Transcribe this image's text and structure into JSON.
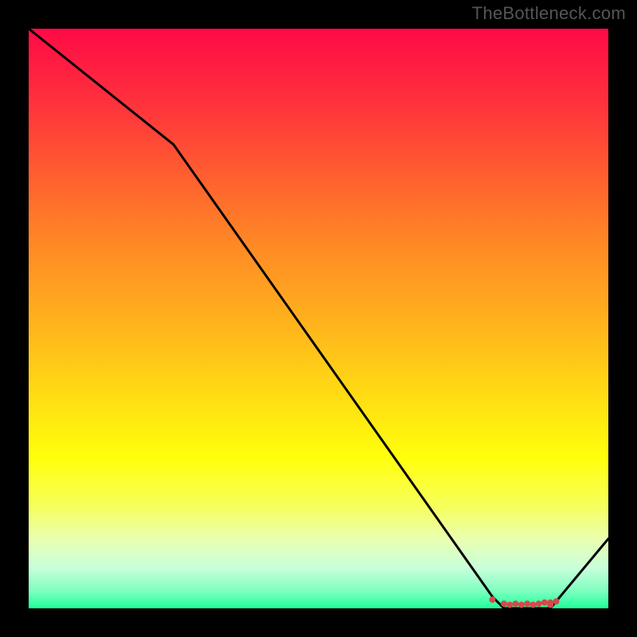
{
  "watermark": "TheBottleneck.com",
  "colors": {
    "red": "#ff0a46",
    "green": "#1fff9a",
    "line": "#000000",
    "marker": "#d44a4a",
    "background": "#000000"
  },
  "chart_data": {
    "type": "line",
    "title": "",
    "xlabel": "",
    "ylabel": "",
    "xlim": [
      0,
      100
    ],
    "ylim": [
      0,
      100
    ],
    "grid": false,
    "legend": false,
    "x": [
      0,
      25,
      80,
      82,
      88,
      90,
      100
    ],
    "values": [
      100,
      80,
      2,
      0,
      0,
      0,
      12
    ],
    "markers_x": [
      80,
      82,
      83,
      84,
      85,
      86,
      87,
      88,
      89,
      90,
      90,
      91
    ],
    "markers_y": [
      1.5,
      0.8,
      0.6,
      0.8,
      0.6,
      0.8,
      0.6,
      0.8,
      1.0,
      0.6,
      1.0,
      1.2
    ]
  }
}
